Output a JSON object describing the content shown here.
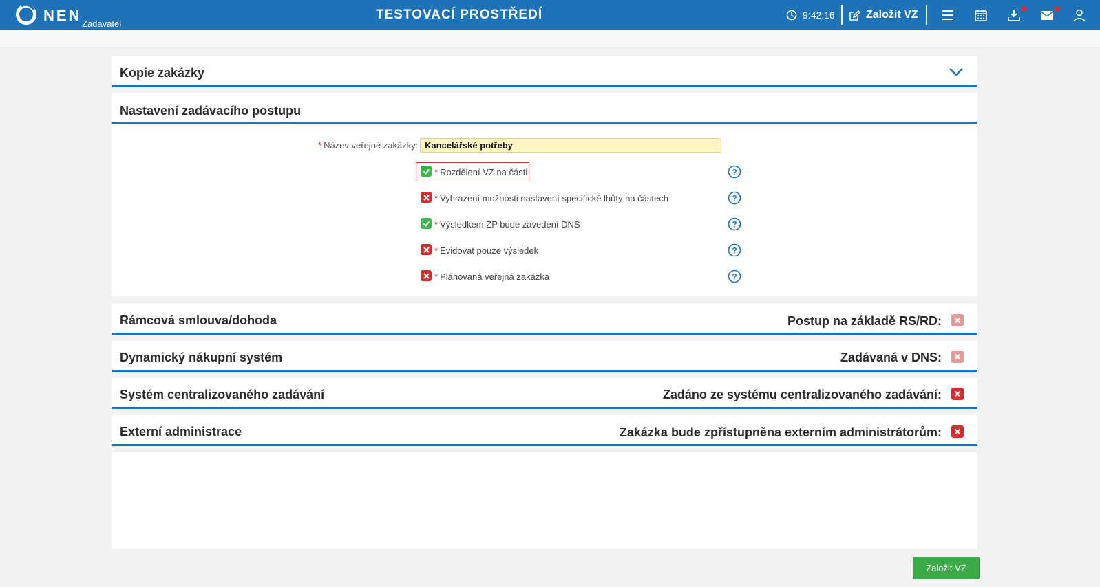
{
  "header": {
    "logo_text": "NEN",
    "logo_sub": "Zadavatel",
    "env_title": "TESTOVACÍ PROSTŘEDÍ",
    "clock": "9:42:16",
    "create_label": "Založit VZ",
    "icons": [
      "clock-icon",
      "edit-icon",
      "menu-icon",
      "calendar-icon",
      "download-icon",
      "mail-icon",
      "user-icon"
    ],
    "accent": "#1e73b8"
  },
  "sections": {
    "copy": {
      "title": "Kopie zakázky"
    },
    "procedure": {
      "title": "Nastavení zadávacího postupu"
    },
    "framework": {
      "title": "Rámcová smlouva/dohoda",
      "right_label": "Postup na základě RS/RD:",
      "value": false
    },
    "dns": {
      "title": "Dynamický nákupní systém",
      "right_label": "Zadávaná v DNS:",
      "value": false
    },
    "central": {
      "title": "Systém centralizovaného zadávání",
      "right_label": "Zadáno ze systému centralizovaného zadávání:",
      "value": false
    },
    "external": {
      "title": "Externí administrace",
      "right_label": "Zakázka bude zpřístupněna externím administrátorům:",
      "value": false
    }
  },
  "form": {
    "name_label": "Název veřejné zakázky:",
    "name_value": "Kancelářské potřeby",
    "required_mark": "*",
    "checkboxes": [
      {
        "label": "Rozdělení VZ na části",
        "checked": true
      },
      {
        "label": "Vyhrazení možnosti nastavení specifické lhůty na částech",
        "checked": false
      },
      {
        "label": "Výsledkem ZP bude zavedení DNS",
        "checked": true
      },
      {
        "label": "Evidovat pouze výsledek",
        "checked": false
      },
      {
        "label": "Plánovaná veřejná zakázka",
        "checked": false
      }
    ]
  },
  "footer": {
    "submit_label": "Založit VZ"
  },
  "colors": {
    "check_on": "#3cb54a",
    "check_off": "#d32f2f",
    "primary": "#1e73b8",
    "submit": "#3cab4a"
  }
}
